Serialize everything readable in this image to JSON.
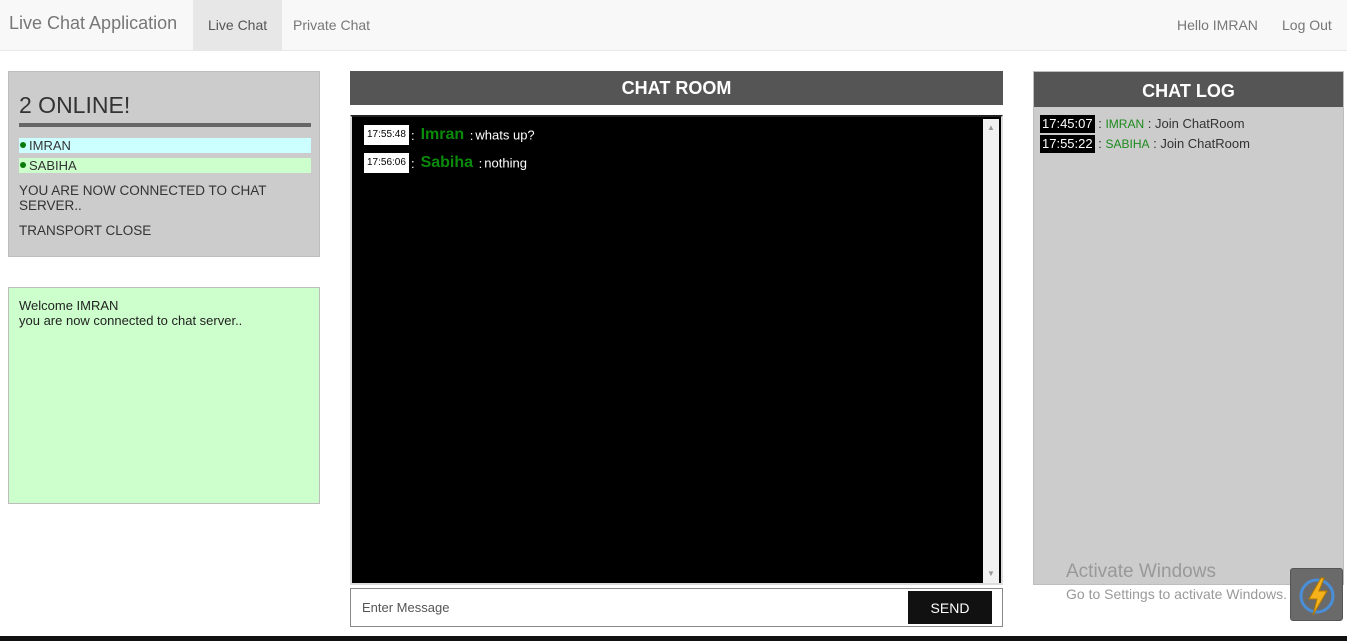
{
  "navbar": {
    "brand": "Live Chat Application",
    "tabs": [
      {
        "label": "Live Chat",
        "active": true
      },
      {
        "label": "Private Chat",
        "active": false
      }
    ],
    "greeting": "Hello IMRAN",
    "logout": "Log Out"
  },
  "online": {
    "title": "2 ONLINE!",
    "users": [
      {
        "name": "IMRAN",
        "highlight": "#ccffff"
      },
      {
        "name": "SABIHA",
        "highlight": "#ccffcc"
      }
    ],
    "status_1": "YOU ARE NOW CONNECTED TO CHAT SERVER..",
    "status_2": "TRANSPORT CLOSE"
  },
  "welcome": {
    "line_1": "Welcome IMRAN",
    "line_2": "you are now connected to chat server.."
  },
  "chat_room": {
    "title": "CHAT ROOM",
    "messages": [
      {
        "time": "17:55:48",
        "sender": "Imran",
        "text": "whats up?"
      },
      {
        "time": "17:56:06",
        "sender": "Sabiha",
        "text": "nothing"
      }
    ],
    "input_placeholder": "Enter Message",
    "send_label": "SEND"
  },
  "chat_log": {
    "title": "CHAT LOG",
    "entries": [
      {
        "time": "17:45:07",
        "user": "IMRAN",
        "action": "Join ChatRoom"
      },
      {
        "time": "17:55:22",
        "user": "SABIHA",
        "action": "Join ChatRoom"
      }
    ]
  },
  "watermark": {
    "line_1": "Activate Windows",
    "line_2": "Go to Settings to activate Windows."
  },
  "colors": {
    "accent_green": "#0a8a0a",
    "header_bg": "#555555",
    "panel_bg": "#cccccc",
    "welcome_bg": "#ccffcc"
  }
}
